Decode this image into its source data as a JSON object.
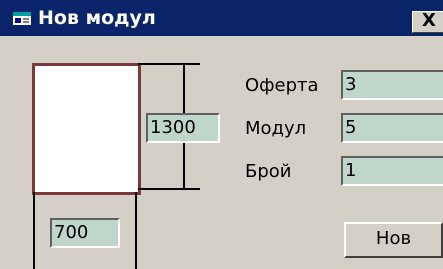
{
  "window": {
    "title": "Нов модул",
    "close_label": "X"
  },
  "dimensions": {
    "height_value": "1300",
    "width_value": "700"
  },
  "form": {
    "offer_label": "Оферта",
    "offer_value": "3",
    "module_label": "Модул",
    "module_value": "5",
    "count_label": "Брой",
    "count_value": "1"
  },
  "actions": {
    "new_label": "Нов"
  },
  "colors": {
    "titlebar": "#0a246a",
    "window_bg": "#d4d0c8",
    "field_bg": "#bfd6cb",
    "preview_border": "#7a3a3a"
  }
}
